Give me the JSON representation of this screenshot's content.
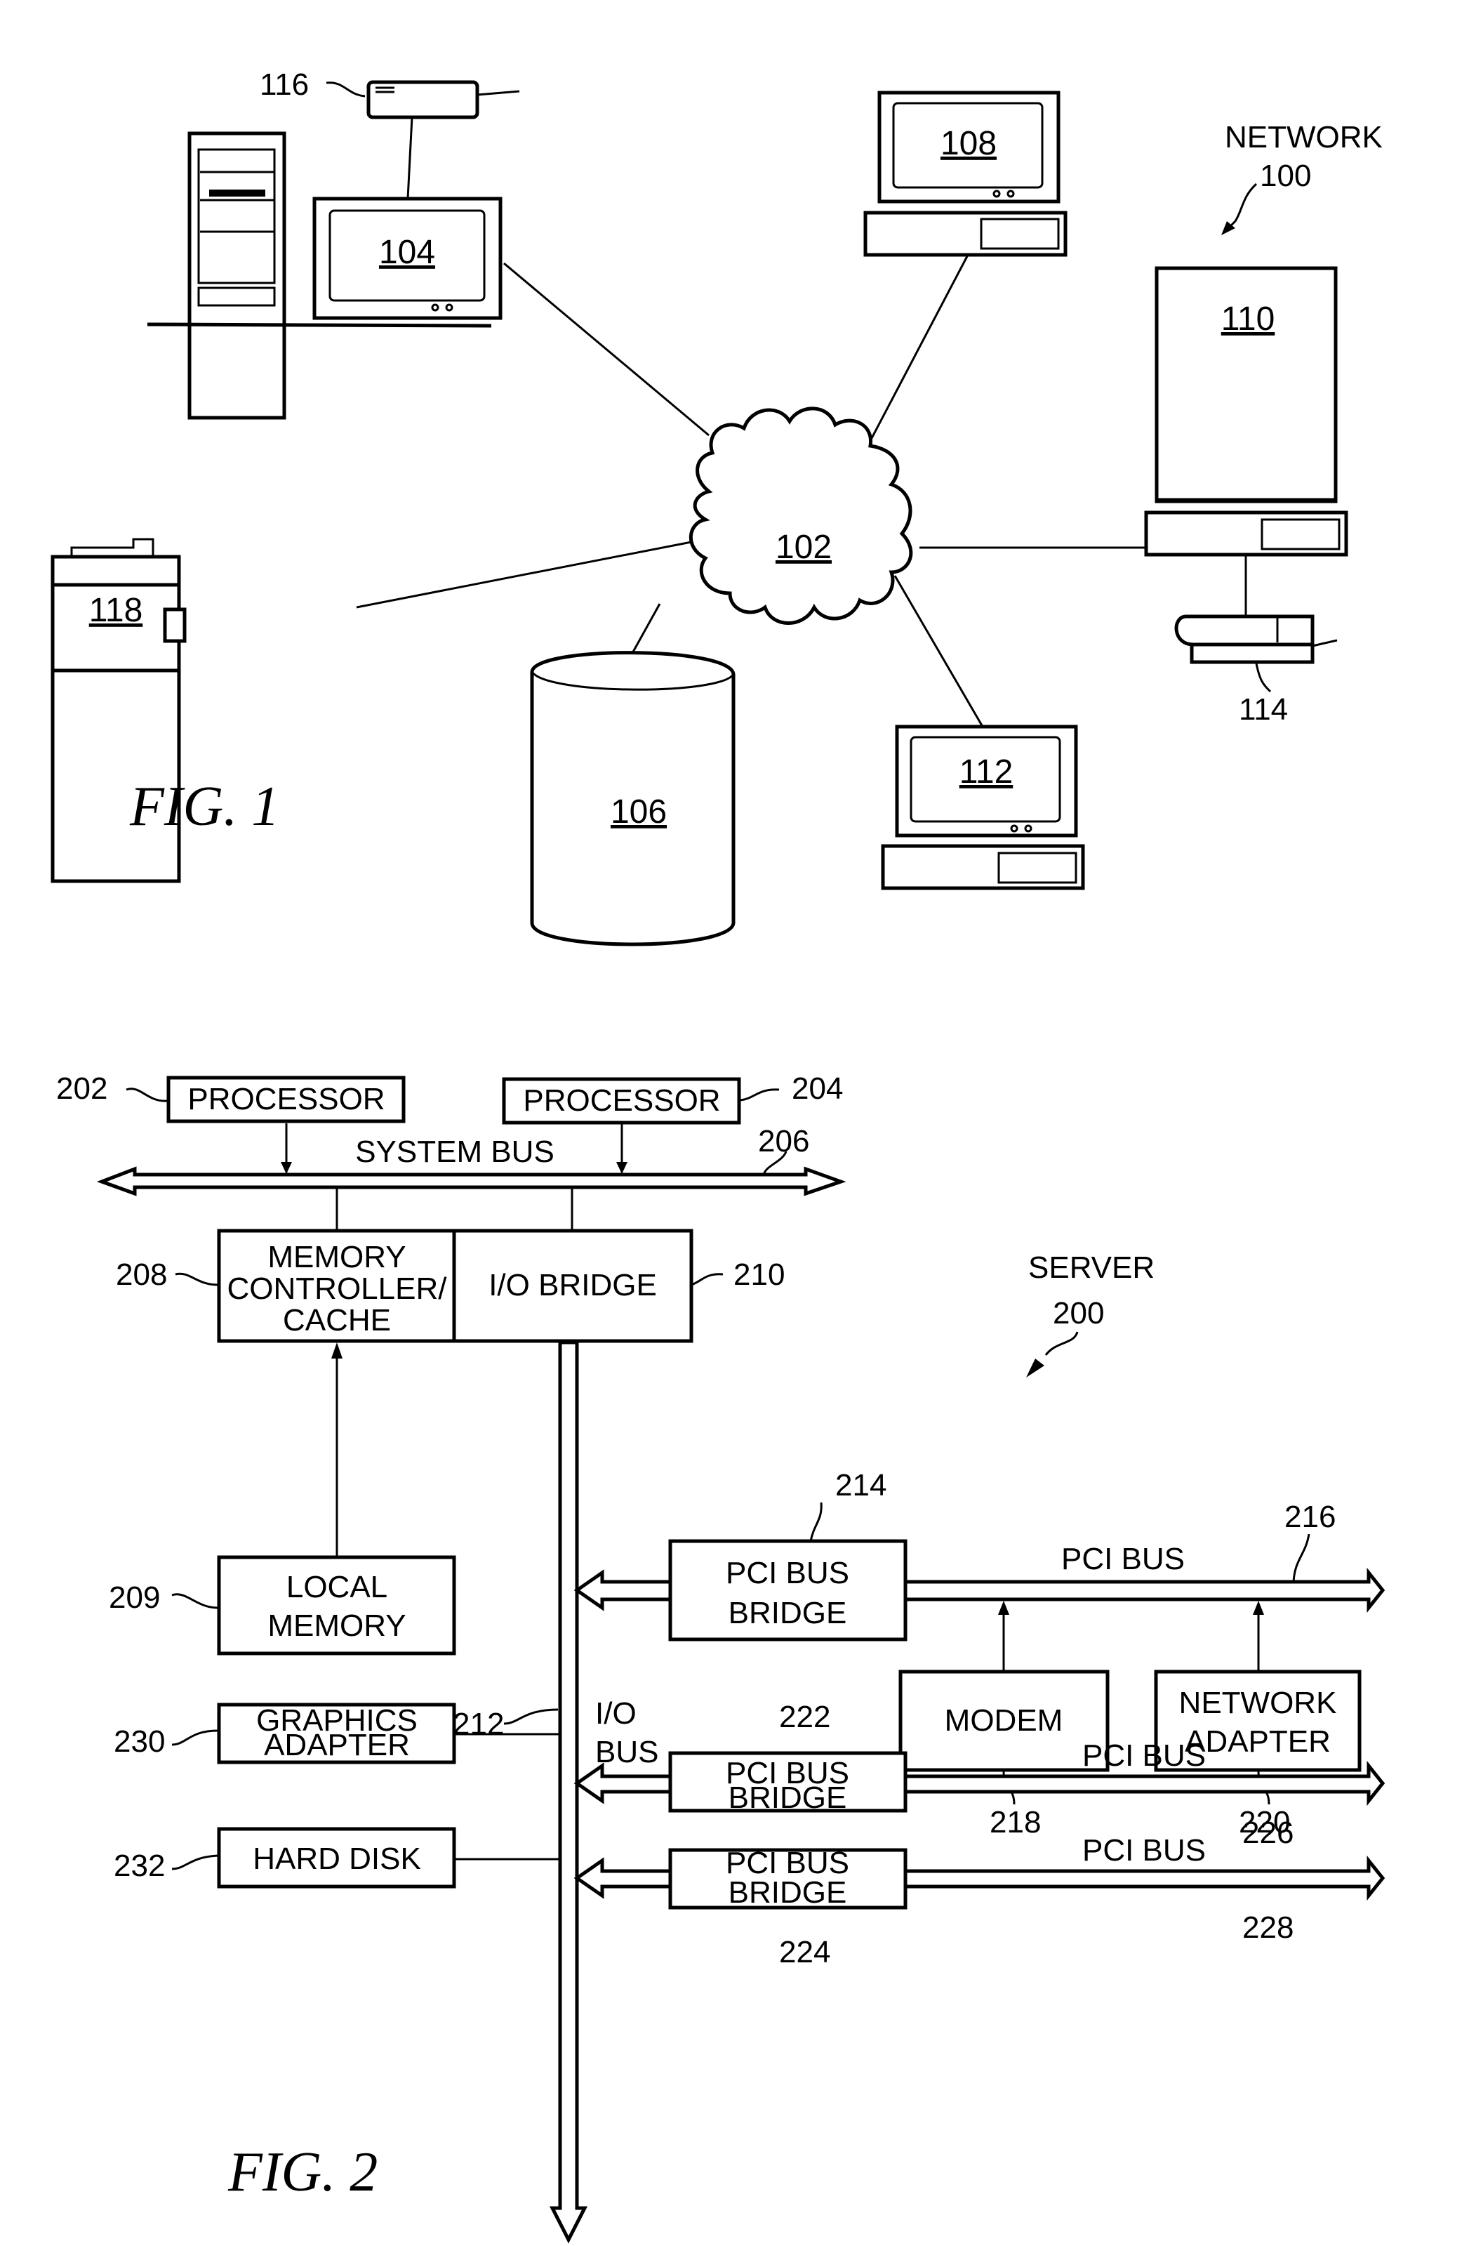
{
  "fig1": {
    "caption": "FIG. 1",
    "title": "NETWORK",
    "title_ref": "100",
    "network": "102",
    "server": "104",
    "storage": "106",
    "client_a": "108",
    "client_b": "110",
    "client_c": "112",
    "client_b_printer": "114",
    "server_device": "116",
    "printer": "118"
  },
  "fig2": {
    "caption": "FIG. 2",
    "title": "SERVER",
    "title_ref": "200",
    "processor_1": {
      "label": "PROCESSOR",
      "ref": "202"
    },
    "processor_2": {
      "label": "PROCESSOR",
      "ref": "204"
    },
    "system_bus": {
      "label": "SYSTEM BUS",
      "ref": "206"
    },
    "memory_controller": {
      "lines": [
        "MEMORY",
        "CONTROLLER/",
        "CACHE"
      ],
      "ref": "208"
    },
    "local_memory": {
      "lines": [
        "LOCAL",
        "MEMORY"
      ],
      "ref": "209"
    },
    "io_bridge": {
      "label": "I/O BRIDGE",
      "ref": "210"
    },
    "io_bus": {
      "lines": [
        "I/O",
        "BUS"
      ],
      "ref": "212"
    },
    "pci_bridge_1": {
      "lines": [
        "PCI BUS",
        "BRIDGE"
      ],
      "ref": "214"
    },
    "pci_bus_1": {
      "label": "PCI BUS",
      "ref": "216"
    },
    "modem": {
      "label": "MODEM",
      "ref": "218"
    },
    "network_adapter": {
      "lines": [
        "NETWORK",
        "ADAPTER"
      ],
      "ref": "220"
    },
    "pci_bridge_2": {
      "lines": [
        "PCI BUS",
        "BRIDGE"
      ],
      "ref": "222"
    },
    "pci_bridge_3": {
      "lines": [
        "PCI BUS",
        "BRIDGE"
      ],
      "ref": "224"
    },
    "pci_bus_2": {
      "label": "PCI BUS",
      "ref": "226"
    },
    "pci_bus_3": {
      "label": "PCI BUS",
      "ref": "228"
    },
    "graphics_adapter": {
      "lines": [
        "GRAPHICS",
        "ADAPTER"
      ],
      "ref": "230"
    },
    "hard_disk": {
      "label": "HARD DISK",
      "ref": "232"
    }
  }
}
